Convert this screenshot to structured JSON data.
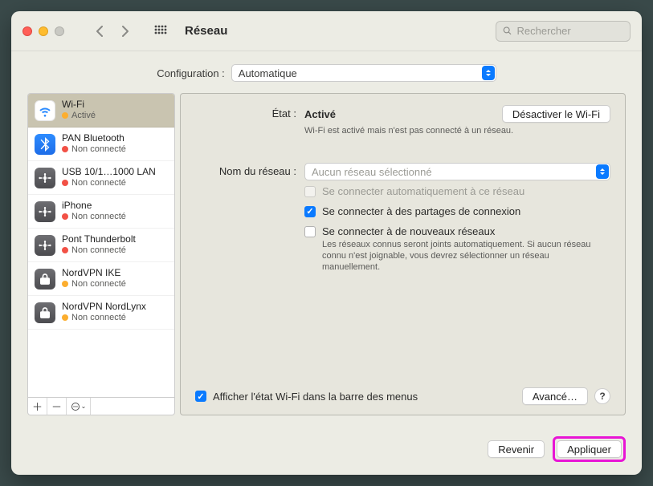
{
  "window": {
    "title": "Réseau"
  },
  "search": {
    "placeholder": "Rechercher"
  },
  "config": {
    "label": "Configuration :",
    "value": "Automatique"
  },
  "services": [
    {
      "name": "Wi-Fi",
      "status": "Activé",
      "status_class": "orange",
      "icon": "wifi",
      "selected": true
    },
    {
      "name": "PAN Bluetooth",
      "status": "Non connecté",
      "status_class": "red",
      "icon": "bluetooth"
    },
    {
      "name": "USB 10/1…1000 LAN",
      "status": "Non connecté",
      "status_class": "red",
      "icon": "ethernet"
    },
    {
      "name": "iPhone",
      "status": "Non connecté",
      "status_class": "red",
      "icon": "ethernet"
    },
    {
      "name": "Pont Thunderbolt",
      "status": "Non connecté",
      "status_class": "red",
      "icon": "ethernet"
    },
    {
      "name": "NordVPN IKE",
      "status": "Non connecté",
      "status_class": "orange",
      "icon": "lock"
    },
    {
      "name": "NordVPN NordLynx",
      "status": "Non connecté",
      "status_class": "orange",
      "icon": "lock"
    }
  ],
  "detail": {
    "state_label": "État :",
    "state_value": "Activé",
    "state_sub": "Wi-Fi est activé mais n'est pas connecté à un réseau.",
    "toggle_btn": "Désactiver le Wi-Fi",
    "network_label": "Nom du réseau :",
    "network_placeholder": "Aucun réseau sélectionné",
    "check_auto": "Se connecter automatiquement à ce réseau",
    "check_share": "Se connecter à des partages de connexion",
    "check_new": "Se connecter à de nouveaux réseaux",
    "new_help": "Les réseaux connus seront joints automatiquement. Si aucun réseau connu n'est joignable, vous devrez sélectionner un réseau manuellement.",
    "show_menu": "Afficher l'état Wi-Fi dans la barre des menus",
    "advanced": "Avancé…"
  },
  "actions": {
    "revert": "Revenir",
    "apply": "Appliquer"
  }
}
